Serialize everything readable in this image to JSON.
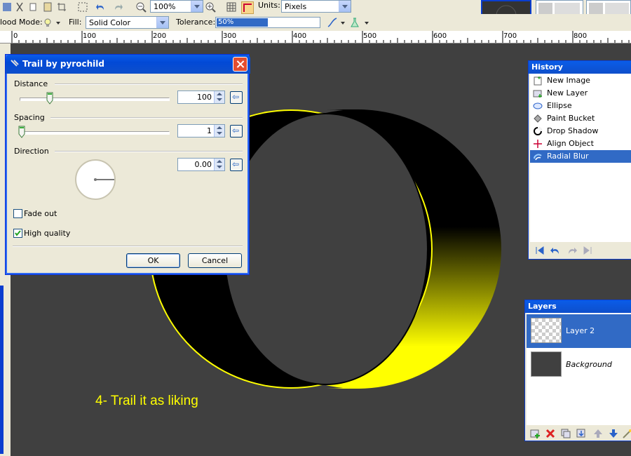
{
  "toolbar": {
    "zoom_value": "100%",
    "units_label": "Units:",
    "units_value": "Pixels",
    "flood_mode_label": "lood Mode:",
    "fill_label": "Fill:",
    "fill_value": "Solid Color",
    "tolerance_label": "Tolerance:",
    "tolerance_value": "50%",
    "tolerance_fraction": 0.5
  },
  "ruler": {
    "ticks": [
      "0",
      "100",
      "200",
      "300",
      "400",
      "500",
      "600",
      "700",
      "800"
    ]
  },
  "dialog": {
    "title": "Trail by pyrochild",
    "distance_label": "Distance",
    "distance_value": "100",
    "spacing_label": "Spacing",
    "spacing_value": "1",
    "direction_label": "Direction",
    "direction_value": "0.00",
    "fade_out_label": "Fade out",
    "fade_out_checked": false,
    "high_quality_label": "High quality",
    "high_quality_checked": true,
    "ok_label": "OK",
    "cancel_label": "Cancel"
  },
  "history": {
    "title": "History",
    "items": [
      {
        "label": "New Image",
        "icon": "new-image-icon"
      },
      {
        "label": "New Layer",
        "icon": "new-layer-icon"
      },
      {
        "label": "Ellipse",
        "icon": "ellipse-icon"
      },
      {
        "label": "Paint Bucket",
        "icon": "paint-bucket-icon"
      },
      {
        "label": "Drop Shadow",
        "icon": "drop-shadow-icon"
      },
      {
        "label": "Align Object",
        "icon": "align-object-icon"
      },
      {
        "label": "Radial Blur",
        "icon": "radial-blur-icon",
        "selected": true
      }
    ]
  },
  "layers": {
    "title": "Layers",
    "items": [
      {
        "label": "Layer 2",
        "selected": true
      },
      {
        "label": "Background",
        "selected": false
      }
    ]
  },
  "caption": "4- Trail it as liking",
  "colors": {
    "accent_yellow": "#ffff00",
    "canvas_gray": "#404040",
    "selection_blue": "#316ac5"
  }
}
